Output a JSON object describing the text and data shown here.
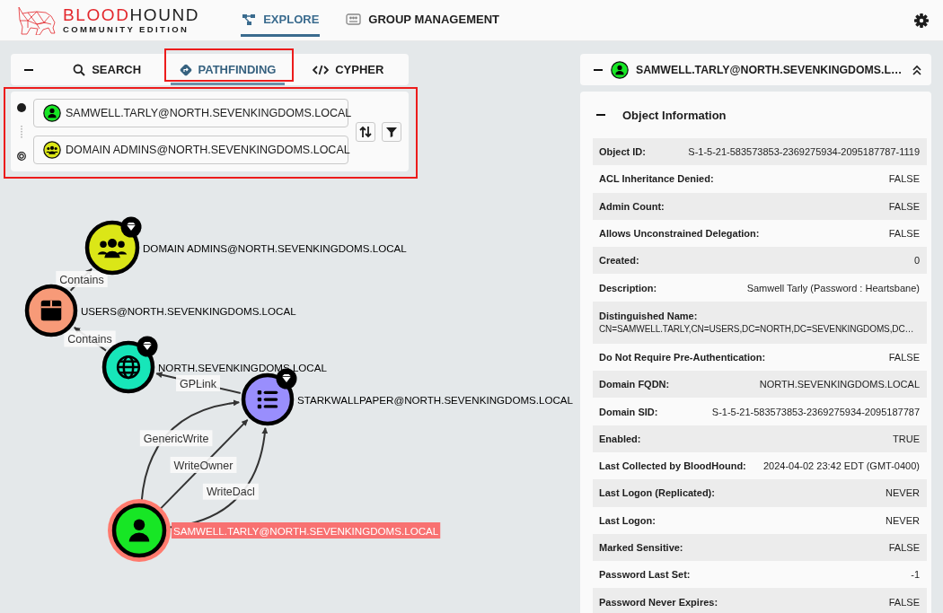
{
  "topbar": {
    "logo": {
      "word_1": "BLOOD",
      "word_2": "HOUND",
      "subtitle": "COMMUNITY EDITION"
    },
    "nav": [
      {
        "label": "EXPLORE",
        "kind": "graph",
        "selected": true
      },
      {
        "label": "GROUP MANAGEMENT",
        "kind": "people-card",
        "selected": false
      }
    ]
  },
  "explore": {
    "tabs": [
      {
        "label": "SEARCH",
        "kind": "search",
        "selected": false,
        "highlighted": false
      },
      {
        "label": "PATHFINDING",
        "kind": "route",
        "selected": true,
        "highlighted": true
      },
      {
        "label": "CYPHER",
        "kind": "code",
        "selected": false,
        "highlighted": false
      }
    ],
    "pathfinding": {
      "highlighted": true,
      "start": {
        "value": "SAMWELL.TARLY@NORTH.SEVENKINGDOMS.LOCAL",
        "kind": "user",
        "color": "#17e625"
      },
      "end": {
        "value": "DOMAIN ADMINS@NORTH.SEVENKINGDOMS.LOCAL",
        "kind": "group",
        "color": "#dbe617"
      }
    }
  },
  "graph": {
    "nodes": [
      {
        "label": "DOMAIN ADMINS@NORTH.SEVENKINGDOMS.LOCAL",
        "kind": "group",
        "color": "#dbe617",
        "tier_zero": true,
        "selected": false
      },
      {
        "label": "USERS@NORTH.SEVENKINGDOMS.LOCAL",
        "kind": "container",
        "color": "#f79a78",
        "tier_zero": false,
        "selected": false
      },
      {
        "label": "NORTH.SEVENKINGDOMS.LOCAL",
        "kind": "domain",
        "color": "#17e6b9",
        "tier_zero": true,
        "selected": false
      },
      {
        "label": "STARKWALLPAPER@NORTH.SEVENKINGDOMS.LOCAL",
        "kind": "gpo",
        "color": "#998efd",
        "tier_zero": true,
        "selected": false
      },
      {
        "label": "SAMWELL.TARLY@NORTH.SEVENKINGDOMS.LOCAL",
        "kind": "user",
        "color": "#17e625",
        "tier_zero": false,
        "selected": true
      }
    ],
    "edges": [
      {
        "label": "Contains"
      },
      {
        "label": "Contains"
      },
      {
        "label": "GPLink"
      },
      {
        "label": "GenericWrite"
      },
      {
        "label": "WriteOwner"
      },
      {
        "label": "WriteDacl"
      }
    ]
  },
  "entity": {
    "title": "SAMWELL.TARLY@NORTH.SEVENKINGDOMS.L…",
    "kind": "user",
    "color": "#17e625",
    "section": {
      "title": "Object Information",
      "expanded": true,
      "rows": [
        {
          "kind": "inline",
          "label": "Object ID:",
          "value": "S-1-5-21-583573853-2369275934-2095187787-1119"
        },
        {
          "kind": "inline",
          "label": "ACL Inheritance Denied:",
          "value": "FALSE"
        },
        {
          "kind": "inline",
          "label": "Admin Count:",
          "value": "FALSE"
        },
        {
          "kind": "inline",
          "label": "Allows Unconstrained Delegation:",
          "value": "FALSE"
        },
        {
          "kind": "inline",
          "label": "Created:",
          "value": "0"
        },
        {
          "kind": "inline",
          "label": "Description:",
          "value": "Samwell Tarly (Password : Heartsbane)"
        },
        {
          "kind": "stacked",
          "label": "Distinguished Name:",
          "value": "CN=SAMWELL.TARLY,CN=USERS,DC=NORTH,DC=SEVENKINGDOMS,DC…"
        },
        {
          "kind": "inline",
          "label": "Do Not Require Pre-Authentication:",
          "value": "FALSE"
        },
        {
          "kind": "inline",
          "label": "Domain FQDN:",
          "value": "NORTH.SEVENKINGDOMS.LOCAL"
        },
        {
          "kind": "inline",
          "label": "Domain SID:",
          "value": "S-1-5-21-583573853-2369275934-2095187787"
        },
        {
          "kind": "inline",
          "label": "Enabled:",
          "value": "TRUE"
        },
        {
          "kind": "inline",
          "label": "Last Collected by BloodHound:",
          "value": "2024-04-02 23:42 EDT (GMT-0400)"
        },
        {
          "kind": "inline",
          "label": "Last Logon (Replicated):",
          "value": "NEVER"
        },
        {
          "kind": "inline",
          "label": "Last Logon:",
          "value": "NEVER"
        },
        {
          "kind": "inline",
          "label": "Marked Sensitive:",
          "value": "FALSE"
        },
        {
          "kind": "inline",
          "label": "Password Last Set:",
          "value": "-1"
        },
        {
          "kind": "inline",
          "label": "Password Never Expires:",
          "value": "FALSE"
        }
      ]
    }
  }
}
